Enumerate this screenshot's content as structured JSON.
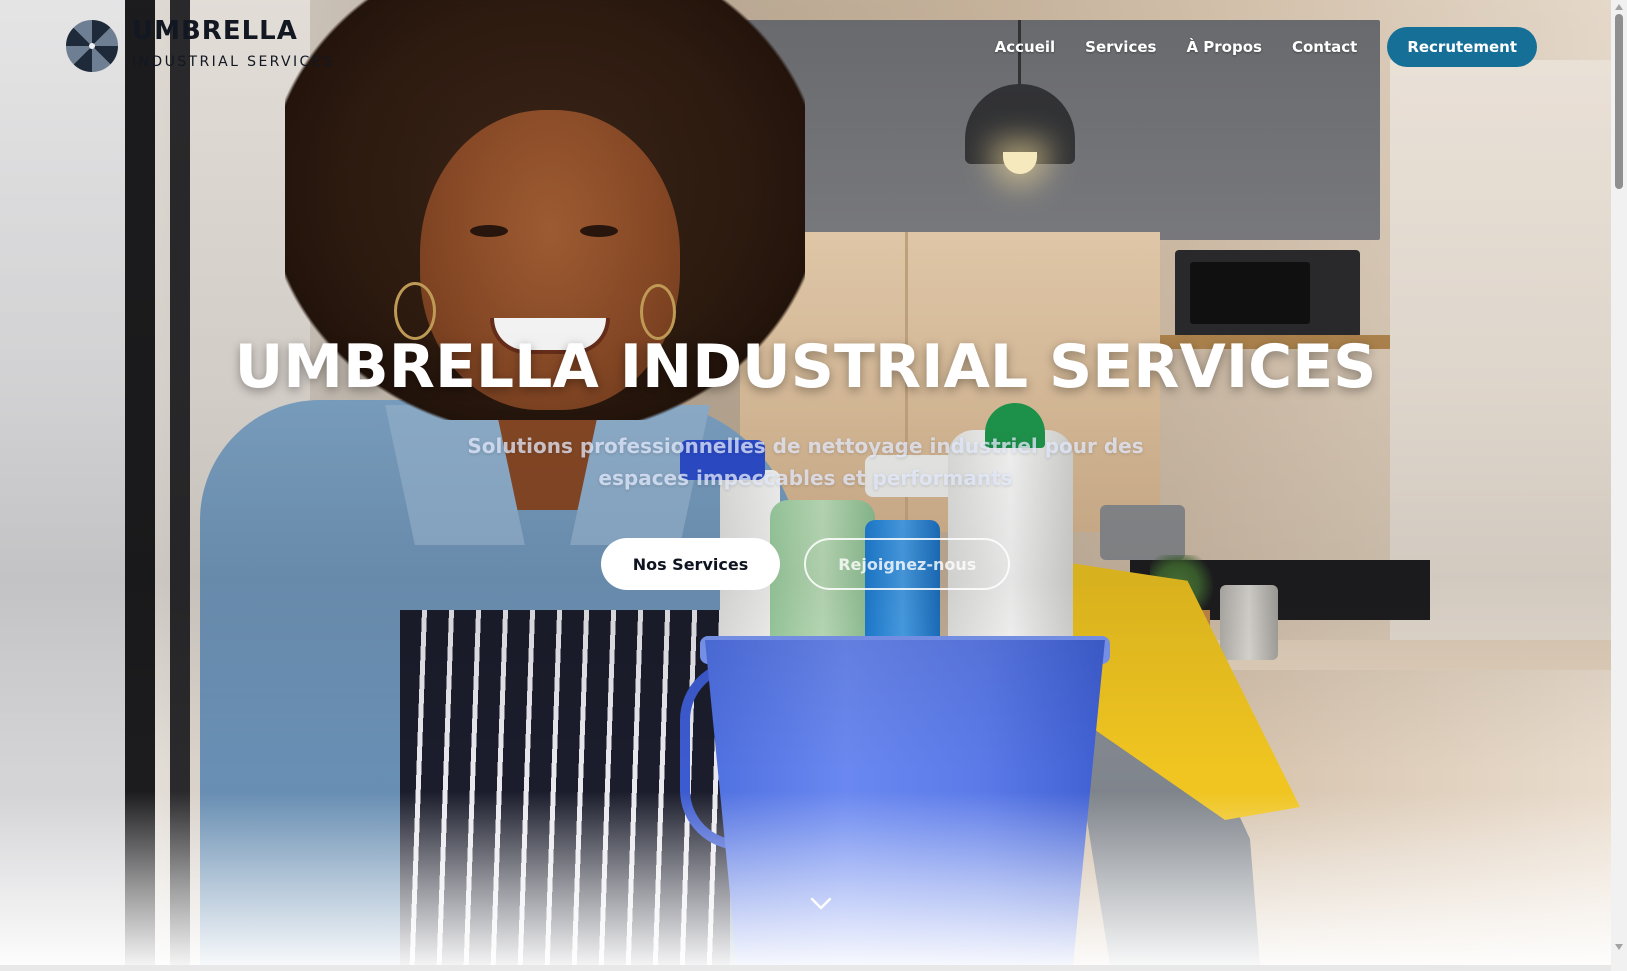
{
  "brand": {
    "title": "UMBRELLA",
    "subtitle": "INDUSTRIAL SERVICES",
    "logo_icon": "umbrella-logo-icon",
    "logo_colors": [
      "#1e2a3a",
      "#6f7f93",
      "#c9d1db"
    ]
  },
  "nav": {
    "items": [
      {
        "label": "Accueil"
      },
      {
        "label": "Services"
      },
      {
        "label": "À Propos"
      },
      {
        "label": "Contact"
      }
    ],
    "cta_label": "Recrutement"
  },
  "hero": {
    "title": "UMBRELLA INDUSTRIAL SERVICES",
    "subtitle": "Solutions professionnelles de nettoyage industriel pour des espaces impeccables et performants",
    "primary_button": "Nos Services",
    "secondary_button": "Rejoignez-nous",
    "scroll_icon": "chevron-down-icon"
  },
  "colors": {
    "accent": "#166f97",
    "text_dark": "#121722",
    "hero_text": "#ffffff"
  }
}
